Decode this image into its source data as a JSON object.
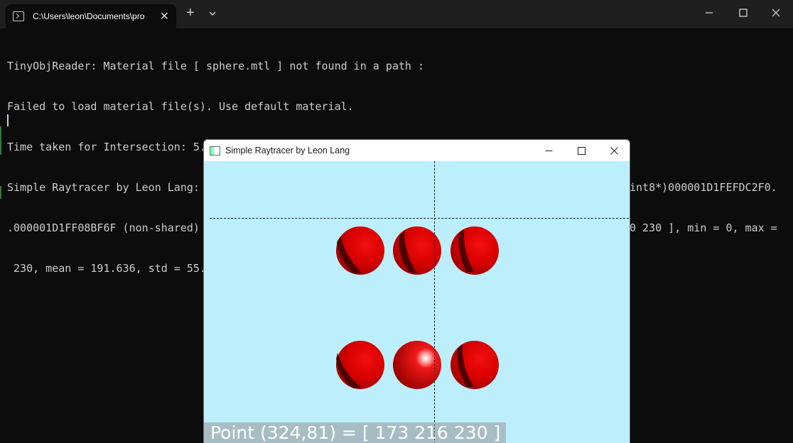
{
  "terminal_tab": {
    "title": "C:\\Users\\leon\\Documents\\pro",
    "close_glyph": "✕",
    "new_tab_glyph": "+"
  },
  "terminal_lines": [
    "TinyObjReader: Material file [ sphere.mtl ] not found in a path :",
    "Failed to load material file(s). Use default material.",
    "Time taken for Intersection: 5.56345 seconds",
    "Simple Raytracer by Leon Lang: this = 00000098B9EFE308, size = (600,400,1,3) [703 Kio], data = (uint8*)000001D1FEFDC2F0.",
    ".000001D1FF08BF6F (non-shared) = [ 173 173 173 173 173 173 173 173 ... 230 230 230 230 230 230 230 230 ], min = 0, max =",
    " 230, mean = 191.636, std = 55.8816, coords_min = (214,92,0,1), coords_max = (0,0,0,2)."
  ],
  "app_window": {
    "title": "Simple Raytracer by Leon Lang",
    "status": "Point (324,81) = [ 173 216 230 ]",
    "background_color": "#bdeefc"
  },
  "icons": [
    "terminal-icon",
    "plus-icon",
    "chevron-down-icon",
    "minimize-icon",
    "maximize-icon",
    "close-icon",
    "app-window-icon"
  ]
}
